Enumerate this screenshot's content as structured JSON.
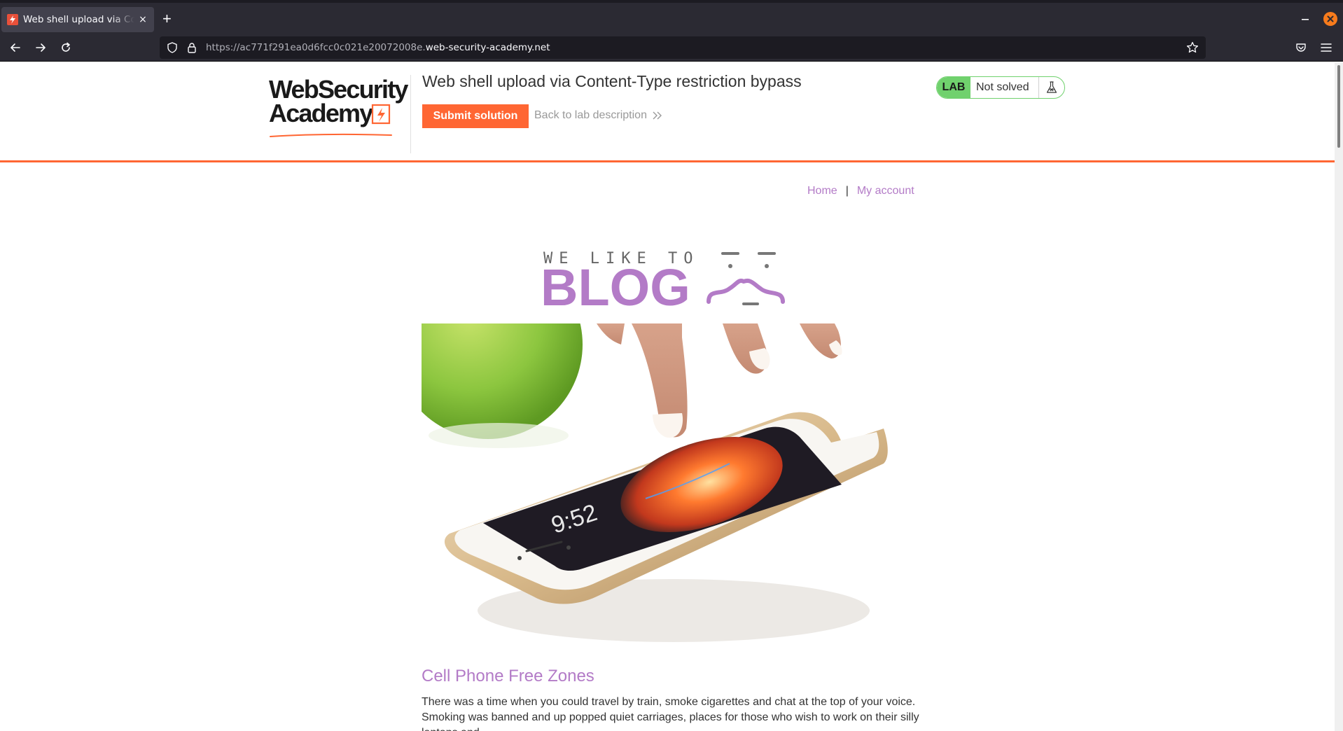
{
  "browser": {
    "tab_title": "Web shell upload via Content-Type restriction bypass",
    "tab_close": "×",
    "new_tab": "+",
    "url_prefix": "https://ac771f291ea0d6fcc0c021e20072008e.",
    "url_domain": "web-security-academy.net"
  },
  "header": {
    "logo_line1": "WebSecurity",
    "logo_line2": "Academy",
    "lab_title": "Web shell upload via Content-Type restriction bypass",
    "submit_label": "Submit solution",
    "back_label": "Back to lab description",
    "status_badge": "LAB",
    "status_text": "Not solved"
  },
  "nav": {
    "home": "Home",
    "separator": "|",
    "account": "My account"
  },
  "banner": {
    "small_text": "WE LIKE TO",
    "big_text": "BLOG"
  },
  "post": {
    "title": "Cell Phone Free Zones",
    "excerpt": "There was a time when you could travel by train, smoke cigarettes and chat at the top of your voice. Smoking was banned and up popped quiet carriages, places for those who wish to work on their silly laptops and"
  },
  "colors": {
    "accent_orange": "#ff6633",
    "link_purple": "#b37bc7",
    "lab_green": "#70d16d"
  },
  "icons": {
    "tab_favicon": "academy-bolt-icon",
    "back": "arrow-left-icon",
    "forward": "arrow-right-icon",
    "reload": "reload-icon",
    "shield": "shield-icon",
    "lock": "lock-icon",
    "bookmark": "star-icon",
    "pocket": "pocket-icon",
    "menu": "hamburger-menu-icon",
    "flask": "flask-icon"
  }
}
